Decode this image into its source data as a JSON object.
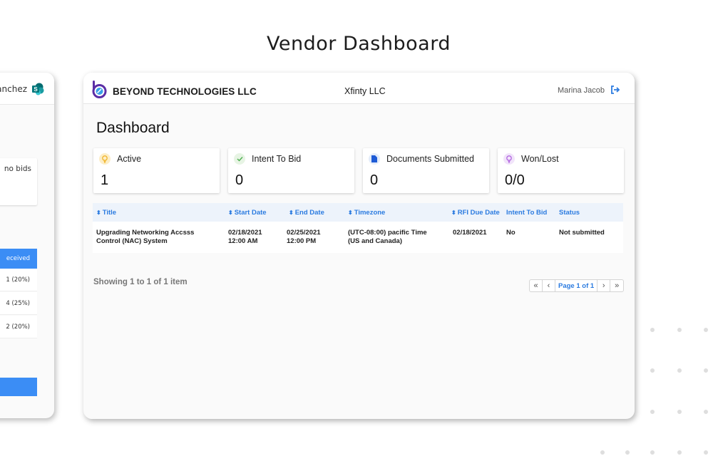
{
  "hero": {
    "title": "Vendor Dashboard"
  },
  "side_panel": {
    "user_name_partial": "anchez",
    "app_icon": "sharepoint-icon",
    "note_partial": "no bids",
    "table_header_partial": "eceived",
    "rows_partial": [
      "1 (20%)",
      "4 (25%)",
      "2 (20%)"
    ]
  },
  "header": {
    "logo_icon": "beyond-logo-icon",
    "company": "BEYOND TECHNOLOGIES LLC",
    "client": "Xfinty LLC",
    "user": "Marina Jacob",
    "logout_icon": "logout-icon"
  },
  "page": {
    "title": "Dashboard"
  },
  "stats": [
    {
      "label": "Active",
      "value": "1",
      "icon": "lightbulb-icon",
      "icon_bg": "#fdeec7",
      "icon_color": "#f0b429"
    },
    {
      "label": "Intent To Bid",
      "value": "0",
      "icon": "check-icon",
      "icon_bg": "#e7f4e4",
      "icon_color": "#4caf50"
    },
    {
      "label": "Documents Submitted",
      "value": "0",
      "icon": "document-icon",
      "icon_bg": "#e3ecfa",
      "icon_color": "#1e5bd6"
    },
    {
      "label": "Won/Lost",
      "value": "0/0",
      "icon": "award-icon",
      "icon_bg": "#f1e4fa",
      "icon_color": "#b266e0"
    }
  ],
  "table": {
    "columns": [
      {
        "label": "Title",
        "sortable": true
      },
      {
        "label": "Start Date",
        "sortable": true
      },
      {
        "label": "End Date",
        "sortable": true
      },
      {
        "label": "Timezone",
        "sortable": true
      },
      {
        "label": "RFI Due Date",
        "sortable": true
      },
      {
        "label": "Intent To Bid",
        "sortable": false
      },
      {
        "label": "Status",
        "sortable": false
      }
    ],
    "rows": [
      {
        "title_line1": "Upgrading Networking Accsss",
        "title_line2": "Control (NAC) System",
        "start_line1": "02/18/2021",
        "start_line2": "12:00 AM",
        "end_line1": "02/25/2021",
        "end_line2": "12:00 PM",
        "tz_line1": "(UTC-08:00)  pacific Time",
        "tz_line2": "(US and Canada)",
        "rfi_due": "02/18/2021",
        "intent": "No",
        "status": "Not submitted"
      }
    ]
  },
  "footer": {
    "showing": "Showing 1 to 1 of 1 item",
    "pager": {
      "first": "«",
      "prev": "‹",
      "current": "Page 1 of 1",
      "next": "›",
      "last": "»"
    }
  },
  "colors": {
    "accent": "#2b7be0",
    "panel_blue": "#3b8df5"
  }
}
